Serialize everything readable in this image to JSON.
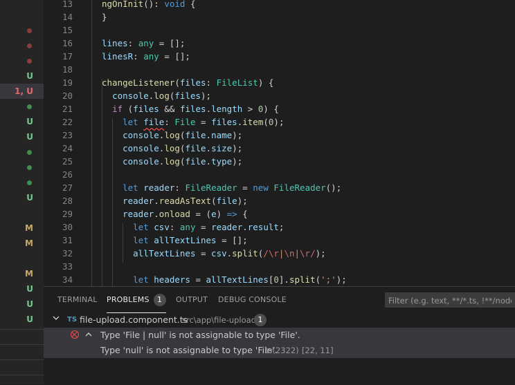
{
  "sidebar": {
    "decorations": [
      {
        "type": "dot",
        "color": "#8b3c3c"
      },
      {
        "type": "dot",
        "color": "#8b3c3c"
      },
      {
        "type": "dot",
        "color": "#8b3c3c"
      },
      {
        "type": "text",
        "text": "U",
        "color": "#73c991"
      },
      {
        "type": "text",
        "text": "1, U",
        "color": "#e06c6c",
        "selected": true
      },
      {
        "type": "dot",
        "color": "#3e8f4c"
      },
      {
        "type": "text",
        "text": "U",
        "color": "#73c991"
      },
      {
        "type": "text",
        "text": "U",
        "color": "#73c991"
      },
      {
        "type": "dot",
        "color": "#3e8f4c"
      },
      {
        "type": "dot",
        "color": "#3e8f4c"
      },
      {
        "type": "dot",
        "color": "#3e8f4c"
      },
      {
        "type": "text",
        "text": "U",
        "color": "#73c991"
      },
      {
        "type": "none"
      },
      {
        "type": "text",
        "text": "M",
        "color": "#c5a96b"
      },
      {
        "type": "text",
        "text": "M",
        "color": "#c5a96b"
      },
      {
        "type": "none"
      },
      {
        "type": "text",
        "text": "M",
        "color": "#c5a96b"
      },
      {
        "type": "text",
        "text": "U",
        "color": "#73c991"
      },
      {
        "type": "text",
        "text": "U",
        "color": "#73c991"
      },
      {
        "type": "text",
        "text": "U",
        "color": "#73c991"
      }
    ]
  },
  "editor": {
    "line_numbers": [
      "13",
      "14",
      "15",
      "16",
      "17",
      "18",
      "19",
      "20",
      "21",
      "22",
      "23",
      "24",
      "25",
      "26",
      "27",
      "28",
      "29",
      "30",
      "31",
      "32",
      "33",
      "34"
    ]
  },
  "panel": {
    "tabs": {
      "terminal": "TERMINAL",
      "problems": "PROBLEMS",
      "problems_count": "1",
      "output": "OUTPUT",
      "debug_console": "DEBUG CONSOLE"
    },
    "filter_placeholder": "Filter (e.g. text, **/*.ts, !**/node_modules/**)",
    "file": {
      "badge": "TS",
      "name": "file-upload.component.ts",
      "path": "src\\app\\file-upload",
      "count": "1"
    },
    "problem": {
      "message": "Type 'File | null' is not assignable to type 'File'.",
      "detail": "Type 'null' is not assignable to type 'File'.",
      "code": "ts(2322)",
      "position": "[22, 11]"
    }
  }
}
